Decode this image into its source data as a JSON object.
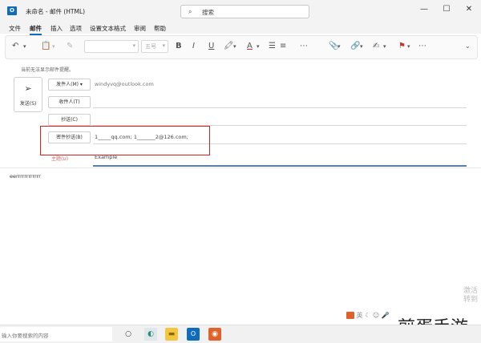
{
  "window": {
    "title": "未命名 - 邮件 (HTML)",
    "search_placeholder": "搜索",
    "controls": {
      "minimize": "—",
      "maximize": "☐",
      "close": "✕"
    }
  },
  "menu": {
    "items": [
      "文件",
      "邮件",
      "插入",
      "选项",
      "设置文本格式",
      "审阅",
      "帮助"
    ],
    "active": "邮件"
  },
  "ribbon": {
    "font_size": "五号",
    "bold": "B",
    "italic": "I",
    "underline": "U"
  },
  "compose": {
    "info": "当前无法显示邮件提醒。",
    "send_label": "发送(S)",
    "from_label": "发件人(M)",
    "from_value": "windyvq@outlook.com",
    "to_label": "收件人(T)",
    "cc_label": "抄送(C)",
    "bcc_label": "密件抄送(B)",
    "bcc_value": "1_____qq.com; 1_______2@126.com;",
    "subject_label": "主题(U)",
    "subject_value": "Example",
    "body": "eerrrrrrrrrrrr"
  },
  "watermark": "煎蛋手游",
  "side_watermark": "激活\n转到",
  "taskbar": {
    "search_placeholder": "输入你要搜索的内容"
  },
  "colors": {
    "accent": "#0f6cbd",
    "highlight_box": "#d42020"
  }
}
